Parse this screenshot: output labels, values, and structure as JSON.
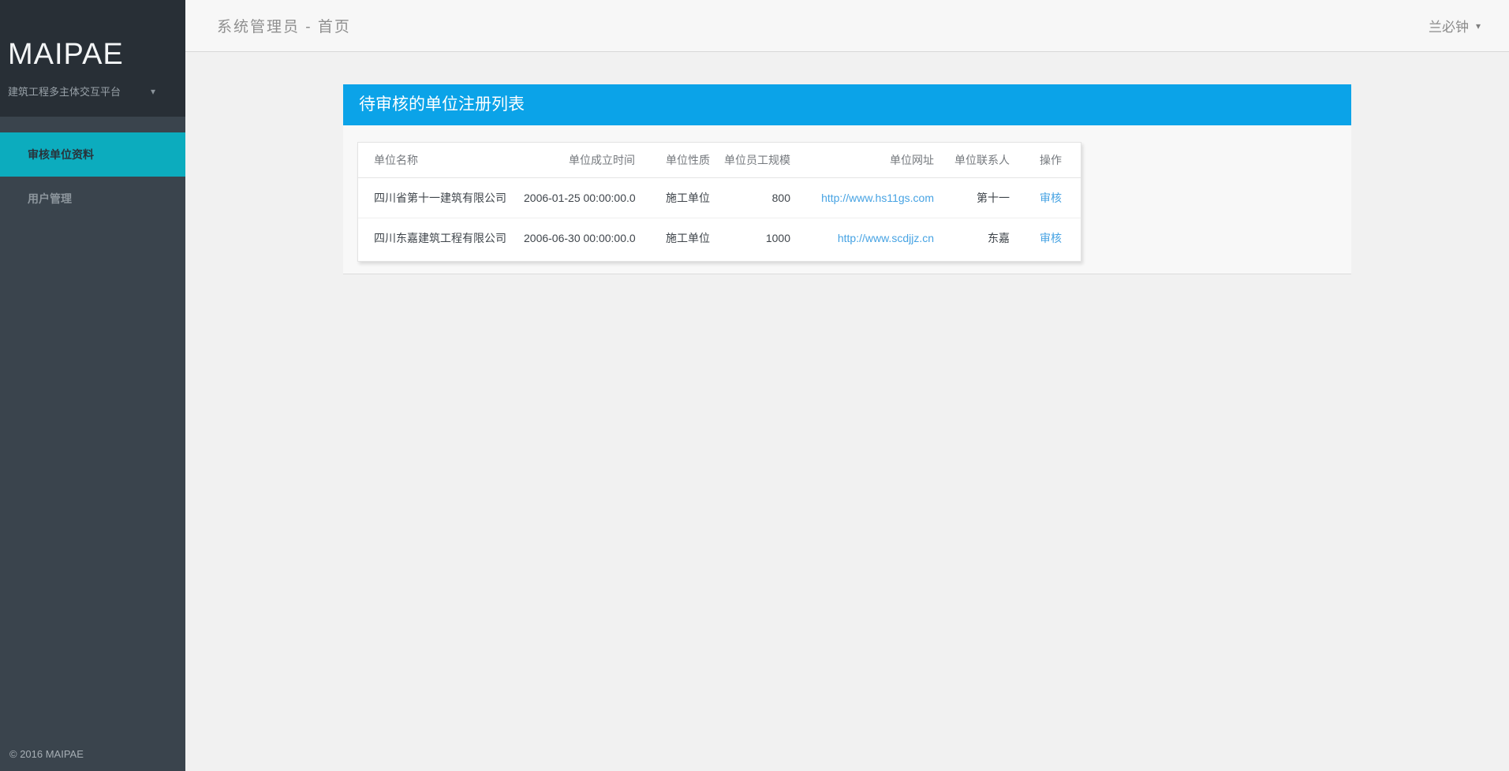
{
  "colors": {
    "sidebar_bg": "#3a444d",
    "brand_block_bg": "#282f36",
    "active_item_bg": "#0cacbe",
    "panel_header_bg": "#0ba3e8",
    "link_blue": "#47a3e3",
    "topbar_bg": "#f7f7f7"
  },
  "icons": {
    "caret_down": "▾"
  },
  "sidebar": {
    "brand": "MAIPAE",
    "brand_subtitle": "建筑工程多主体交互平台",
    "menu": [
      {
        "label": "审核单位资料",
        "active": true
      },
      {
        "label": "用户管理",
        "active": false
      }
    ],
    "footer": "© 2016 MAIPAE"
  },
  "header": {
    "title": "系统管理员 - 首页",
    "user": "兰必钟"
  },
  "panel": {
    "title": "待审核的单位注册列表",
    "table": {
      "columns": [
        {
          "label": "单位名称",
          "align": "left"
        },
        {
          "label": "单位成立时间",
          "align": "right"
        },
        {
          "label": "单位性质",
          "align": "left"
        },
        {
          "label": "单位员工规模",
          "align": "right"
        },
        {
          "label": "单位网址",
          "align": "right"
        },
        {
          "label": "单位联系人",
          "align": "right"
        },
        {
          "label": "操作",
          "align": "left"
        }
      ],
      "rows": [
        {
          "name": "四川省第十一建筑有限公司",
          "founded": "2006-01-25 00:00:00.0",
          "type": "施工单位",
          "size": "800",
          "website": "http://www.hs11gs.com",
          "contact": "第十一",
          "action": "审核"
        },
        {
          "name": "四川东嘉建筑工程有限公司",
          "founded": "2006-06-30 00:00:00.0",
          "type": "施工单位",
          "size": "1000",
          "website": "http://www.scdjjz.cn",
          "contact": "东嘉",
          "action": "审核"
        }
      ]
    }
  }
}
